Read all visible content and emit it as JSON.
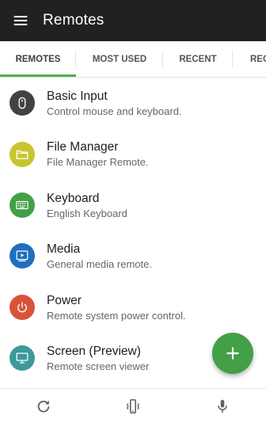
{
  "app": {
    "title": "Remotes",
    "menu_icon": "menu-icon"
  },
  "tabs": [
    {
      "label": "REMOTES",
      "selected": true
    },
    {
      "label": "MOST USED",
      "selected": false
    },
    {
      "label": "RECENT",
      "selected": false
    },
    {
      "label": "REC",
      "selected": false
    }
  ],
  "colors": {
    "appbar": "#212121",
    "accent": "#4caf50",
    "fab": "#43a047"
  },
  "remotes": [
    {
      "title": "Basic Input",
      "subtitle": "Control mouse and keyboard.",
      "icon": "mouse-icon",
      "color": "#424242"
    },
    {
      "title": "File Manager",
      "subtitle": "File Manager Remote.",
      "icon": "folder-icon",
      "color": "#c9c432"
    },
    {
      "title": "Keyboard",
      "subtitle": "English Keyboard",
      "icon": "keyboard-icon",
      "color": "#43a047"
    },
    {
      "title": "Media",
      "subtitle": "General media remote.",
      "icon": "media-icon",
      "color": "#1e6fc0"
    },
    {
      "title": "Power",
      "subtitle": "Remote system power control.",
      "icon": "power-icon",
      "color": "#d9533a"
    },
    {
      "title": "Screen (Preview)",
      "subtitle": "Remote screen viewer",
      "icon": "monitor-icon",
      "color": "#3c9a9a"
    }
  ],
  "fab": {
    "icon": "add-icon"
  },
  "bottom_bar": {
    "refresh_icon": "refresh-icon",
    "remote_icon": "phone-vibrate-icon",
    "mic_icon": "microphone-icon"
  }
}
